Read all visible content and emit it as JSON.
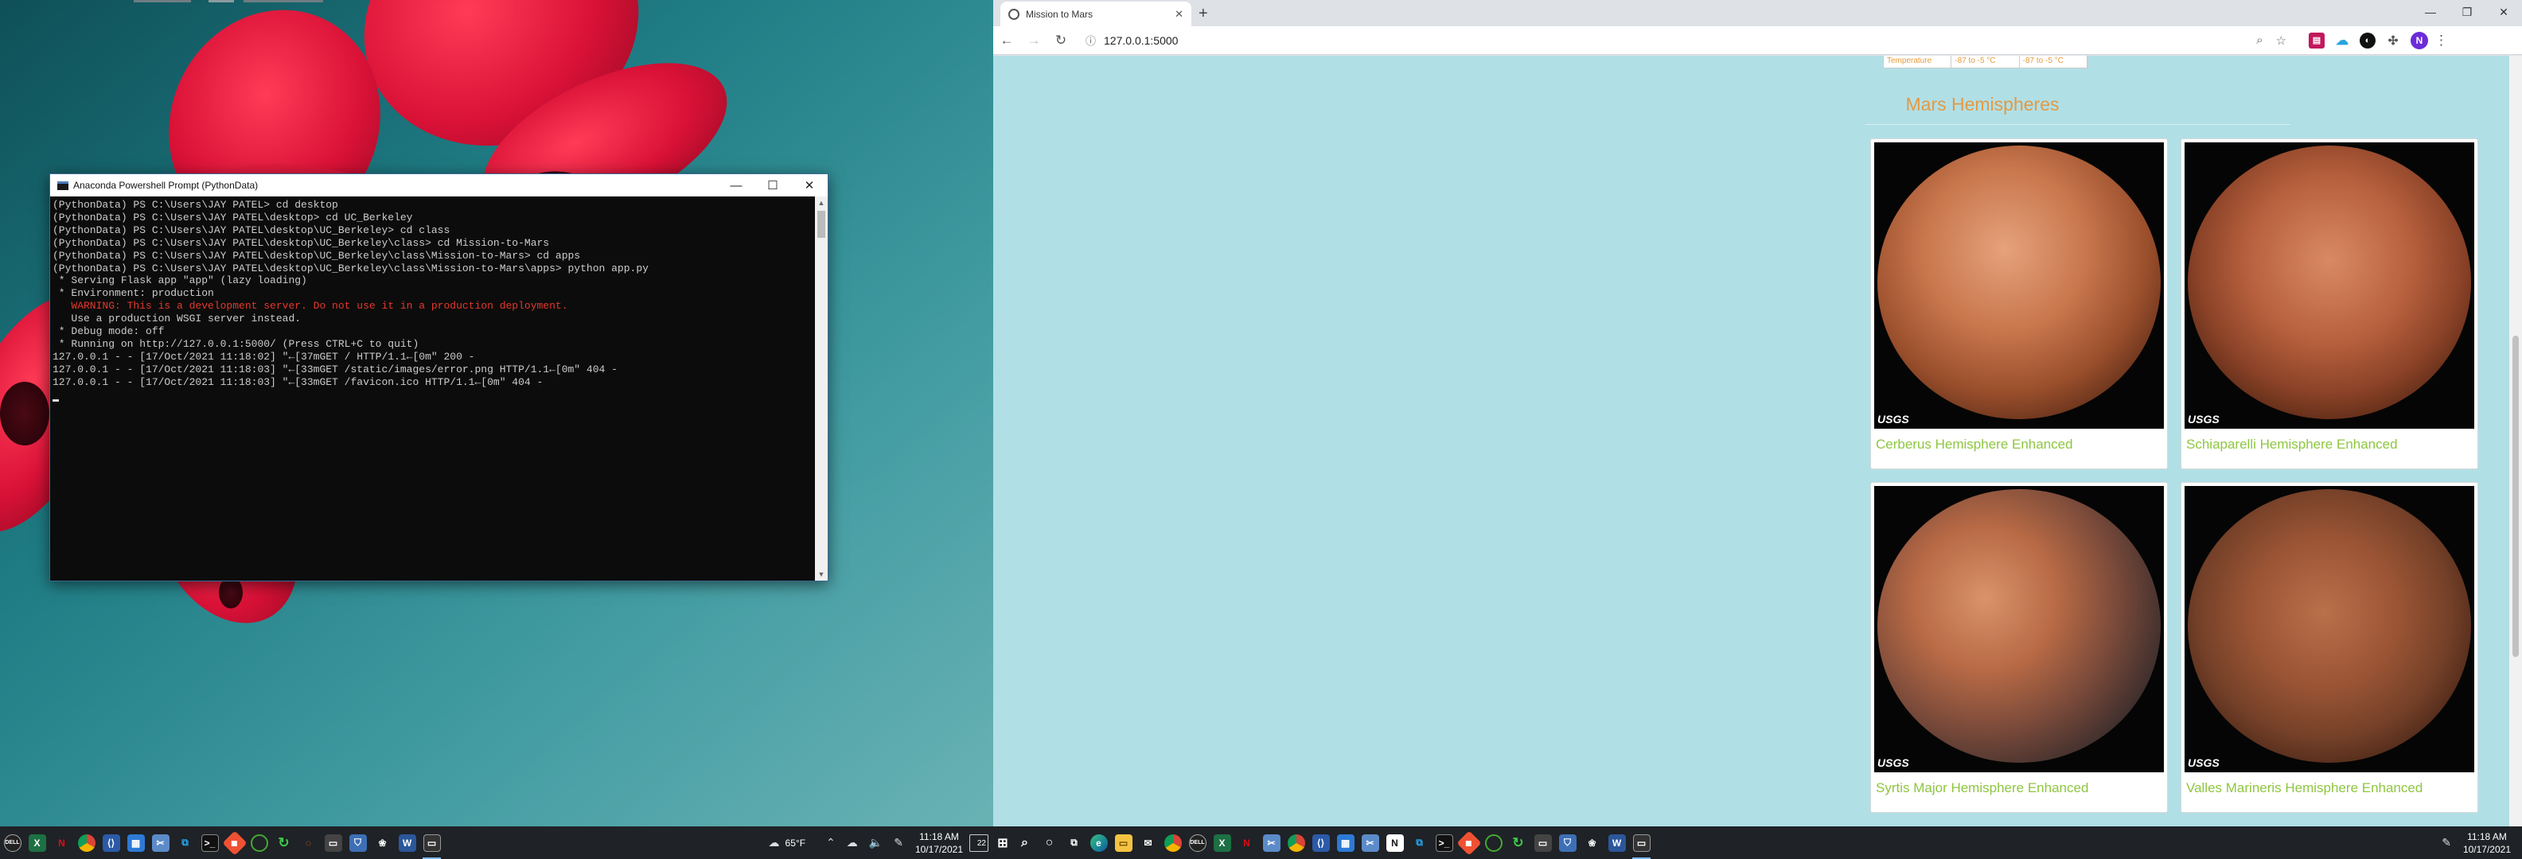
{
  "terminal": {
    "title": "Anaconda Powershell Prompt (PythonData)",
    "lines": [
      {
        "text": "(PythonData) PS C:\\Users\\JAY PATEL> cd desktop",
        "color": "normal"
      },
      {
        "text": "(PythonData) PS C:\\Users\\JAY PATEL\\desktop> cd UC_Berkeley",
        "color": "normal"
      },
      {
        "text": "(PythonData) PS C:\\Users\\JAY PATEL\\desktop\\UC_Berkeley> cd class",
        "color": "normal"
      },
      {
        "text": "(PythonData) PS C:\\Users\\JAY PATEL\\desktop\\UC_Berkeley\\class> cd Mission-to-Mars",
        "color": "normal"
      },
      {
        "text": "(PythonData) PS C:\\Users\\JAY PATEL\\desktop\\UC_Berkeley\\class\\Mission-to-Mars> cd apps",
        "color": "normal"
      },
      {
        "text": "(PythonData) PS C:\\Users\\JAY PATEL\\desktop\\UC_Berkeley\\class\\Mission-to-Mars\\apps> python app.py",
        "color": "normal"
      },
      {
        "text": " * Serving Flask app \"app\" (lazy loading)",
        "color": "normal"
      },
      {
        "text": " * Environment: production",
        "color": "normal"
      },
      {
        "text": "   WARNING: This is a development server. Do not use it in a production deployment.",
        "color": "red"
      },
      {
        "text": "   Use a production WSGI server instead.",
        "color": "normal"
      },
      {
        "text": " * Debug mode: off",
        "color": "normal"
      },
      {
        "text": " * Running on http://127.0.0.1:5000/ (Press CTRL+C to quit)",
        "color": "normal"
      },
      {
        "text": "127.0.0.1 - - [17/Oct/2021 11:18:02] \"←[37mGET / HTTP/1.1←[0m\" 200 -",
        "color": "normal"
      },
      {
        "text": "127.0.0.1 - - [17/Oct/2021 11:18:03] \"←[33mGET /static/images/error.png HTTP/1.1←[0m\" 404 -",
        "color": "normal"
      },
      {
        "text": "127.0.0.1 - - [17/Oct/2021 11:18:03] \"←[33mGET /favicon.ico HTTP/1.1←[0m\" 404 -",
        "color": "normal"
      }
    ]
  },
  "taskbar_left": {
    "weather": "65°F",
    "time": "11:18 AM",
    "date": "10/17/2021",
    "notifications": "22"
  },
  "taskbar_right": {
    "time": "11:18 AM",
    "date": "10/17/2021"
  },
  "browser": {
    "tab_title": "Mission to Mars",
    "tab_close": "✕",
    "new_tab": "+",
    "url": "127.0.0.1:5000",
    "profile_initial": "N",
    "window_min": "—",
    "window_restore": "❐",
    "window_close": "✕"
  },
  "page": {
    "facts_row": [
      "Temperature",
      "-87 to -5 °C",
      "-87 to -5 °C"
    ],
    "hemispheres_title": "Mars Hemispheres",
    "hemispheres": [
      {
        "title": "Cerberus Hemisphere Enhanced",
        "logo": "USGS"
      },
      {
        "title": "Schiaparelli Hemisphere Enhanced",
        "logo": "USGS"
      },
      {
        "title": "Syrtis Major Hemisphere Enhanced",
        "logo": "USGS"
      },
      {
        "title": "Valles Marineris Hemisphere Enhanced",
        "logo": "USGS"
      }
    ]
  }
}
